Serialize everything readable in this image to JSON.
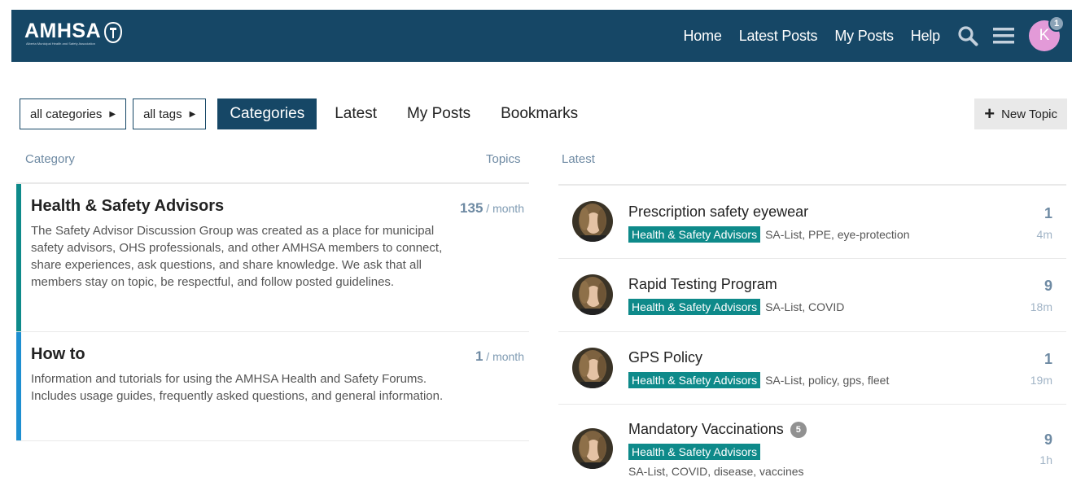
{
  "header": {
    "logo": "AMHSA",
    "logo_sub": "Alberta Municipal Health and Safety Association",
    "nav": [
      "Home",
      "Latest Posts",
      "My Posts",
      "Help"
    ],
    "avatar_letter": "K",
    "notification_count": "1",
    "icons": [
      "search-icon",
      "hamburger-menu-icon"
    ]
  },
  "filters": {
    "categories_dropdown": "all categories",
    "tags_dropdown": "all tags",
    "tabs": [
      "Categories",
      "Latest",
      "My Posts",
      "Bookmarks"
    ],
    "active_tab": "Categories",
    "new_topic": "New Topic"
  },
  "columns": {
    "category": "Category",
    "topics": "Topics",
    "latest": "Latest"
  },
  "categories": [
    {
      "title": "Health & Safety Advisors",
      "description": "The Safety Advisor Discussion Group was created as a place for municipal safety advisors, OHS professionals, and other AMHSA members to connect, share experiences, ask questions, and share knowledge. We ask that all members stay on topic, be respectful, and follow posted guidelines.",
      "count": "135",
      "per": " / month",
      "color": "#0e8a8a"
    },
    {
      "title": "How to",
      "description": "Information and tutorials for using the AMHSA Health and Safety Forums. Includes usage guides, frequently asked questions, and general information.",
      "count": "1",
      "per": " / month",
      "color": "#1e8fd0"
    }
  ],
  "latest": [
    {
      "title": "Prescription safety eyewear",
      "category": "Health & Safety Advisors",
      "tags": "SA-List, PPE, eye-protection",
      "replies": "1",
      "age": "4m"
    },
    {
      "title": "Rapid Testing Program",
      "category": "Health & Safety Advisors",
      "tags": "SA-List, COVID",
      "replies": "9",
      "age": "18m"
    },
    {
      "title": "GPS Policy",
      "category": "Health & Safety Advisors",
      "tags": "SA-List, policy, gps, fleet",
      "replies": "1",
      "age": "19m"
    },
    {
      "title": "Mandatory Vaccinations",
      "badge": "5",
      "category": "Health & Safety Advisors",
      "tags": "SA-List, COVID, disease, vaccines",
      "replies": "9",
      "age": "1h"
    }
  ],
  "colors": {
    "header_bg": "#164766",
    "accent_teal": "#0e8a8a",
    "accent_blue": "#1e8fd0",
    "avatar_bg": "#e39ad8"
  }
}
